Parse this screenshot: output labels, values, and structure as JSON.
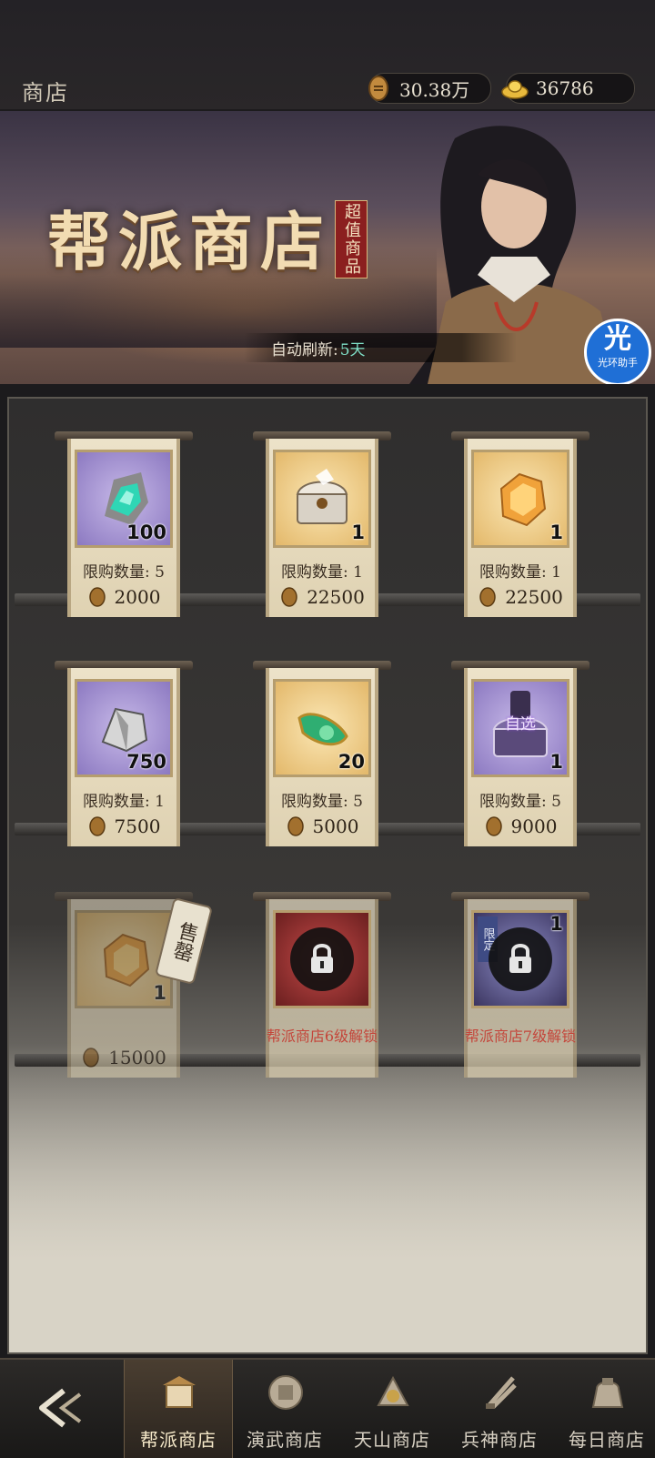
{
  "header": {
    "title": "商店",
    "currencies": [
      {
        "icon": "guild-coin-icon",
        "value": "30.38万"
      },
      {
        "icon": "gold-ingot-icon",
        "value": "36786"
      }
    ]
  },
  "banner": {
    "title": "帮派商店",
    "tag": "超值商品",
    "refresh_label": "自动刷新:",
    "refresh_value": "5天",
    "helper": {
      "big": "光",
      "small": "光环助手"
    }
  },
  "items": [
    {
      "icon": "jade-ore-icon",
      "bg": "purple",
      "qty": "100",
      "limit": "限购数量: 5",
      "price": "2000"
    },
    {
      "icon": "treasure-chest-icon",
      "bg": "gold",
      "qty": "1",
      "limit": "限购数量: 1",
      "price": "22500"
    },
    {
      "icon": "golden-token-icon",
      "bg": "gold",
      "qty": "1",
      "limit": "限购数量: 1",
      "price": "22500"
    },
    {
      "icon": "silver-ore-icon",
      "bg": "purple",
      "qty": "750",
      "limit": "限购数量: 1",
      "price": "7500"
    },
    {
      "icon": "jade-pendant-icon",
      "bg": "gold",
      "qty": "20",
      "limit": "限购数量: 5",
      "price": "5000"
    },
    {
      "icon": "selectable-chest-icon",
      "bg": "purple",
      "qty": "1",
      "limit": "限购数量: 5",
      "price": "9000",
      "chest_label": "自选"
    },
    {
      "icon": "golden-token-icon",
      "bg": "gold",
      "qty": "1",
      "price": "15000",
      "sold_label": "售罄"
    },
    {
      "icon": "lock-icon",
      "bg": "red",
      "unlock": "帮派商店6级解锁"
    },
    {
      "icon": "lock-icon",
      "bg": "violet",
      "qty": "1",
      "limited": "限定",
      "unlock": "帮派商店7级解锁"
    }
  ],
  "tabs": [
    {
      "label": "帮派商店",
      "icon": "guild-shop-icon",
      "active": true
    },
    {
      "label": "演武商店",
      "icon": "martial-shop-icon"
    },
    {
      "label": "天山商店",
      "icon": "tianshan-shop-icon"
    },
    {
      "label": "兵神商店",
      "icon": "weapon-shop-icon"
    },
    {
      "label": "每日商店",
      "icon": "daily-shop-icon"
    }
  ],
  "colors": {
    "accent_gold": "#f2dcb2",
    "lock_text": "#c4453a",
    "refresh_value": "#7fe0c8"
  }
}
